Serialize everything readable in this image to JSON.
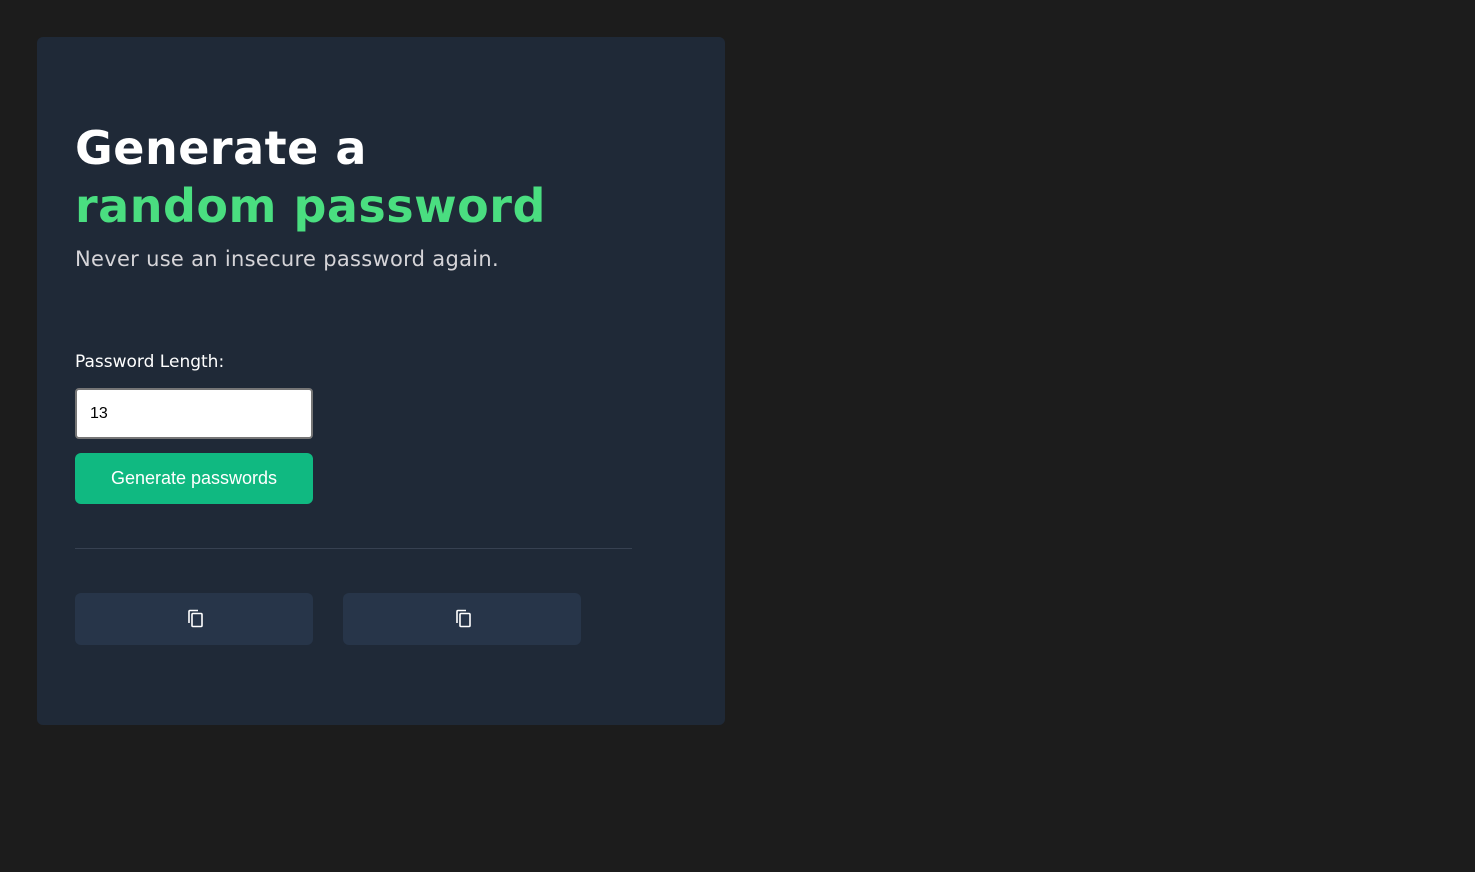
{
  "header": {
    "title_line1": "Generate a",
    "title_line2": "random password",
    "subtitle": "Never use an insecure password again."
  },
  "form": {
    "length_label": "Password Length:",
    "length_value": "13",
    "generate_label": "Generate passwords"
  },
  "passwords": [
    {
      "value": "",
      "icon": "copy-icon"
    },
    {
      "value": "",
      "icon": "copy-icon"
    }
  ],
  "colors": {
    "page_bg": "#1c1c1c",
    "card_bg": "#1f2937",
    "accent": "#4ade80",
    "button": "#10b981",
    "password_box": "#273549"
  }
}
